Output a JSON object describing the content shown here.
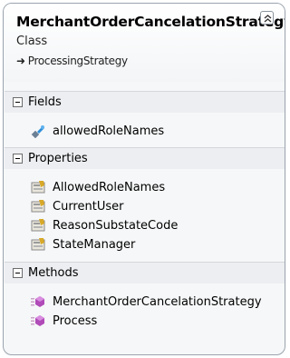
{
  "class": {
    "name": "MerchantOrderCancelationStrategy",
    "kind": "Class",
    "base": "ProcessingStrategy"
  },
  "sections": {
    "fields": {
      "title": "Fields",
      "items": [
        "allowedRoleNames"
      ]
    },
    "properties": {
      "title": "Properties",
      "items": [
        "AllowedRoleNames",
        "CurrentUser",
        "ReasonSubstateCode",
        "StateManager"
      ]
    },
    "methods": {
      "title": "Methods",
      "items": [
        "MerchantOrderCancelationStrategy",
        "Process"
      ]
    }
  },
  "icons": {
    "base": "arrow-right-icon",
    "collapse": "double-chevron-up-icon",
    "field": "field-icon",
    "property": "property-icon",
    "method": "method-icon"
  }
}
